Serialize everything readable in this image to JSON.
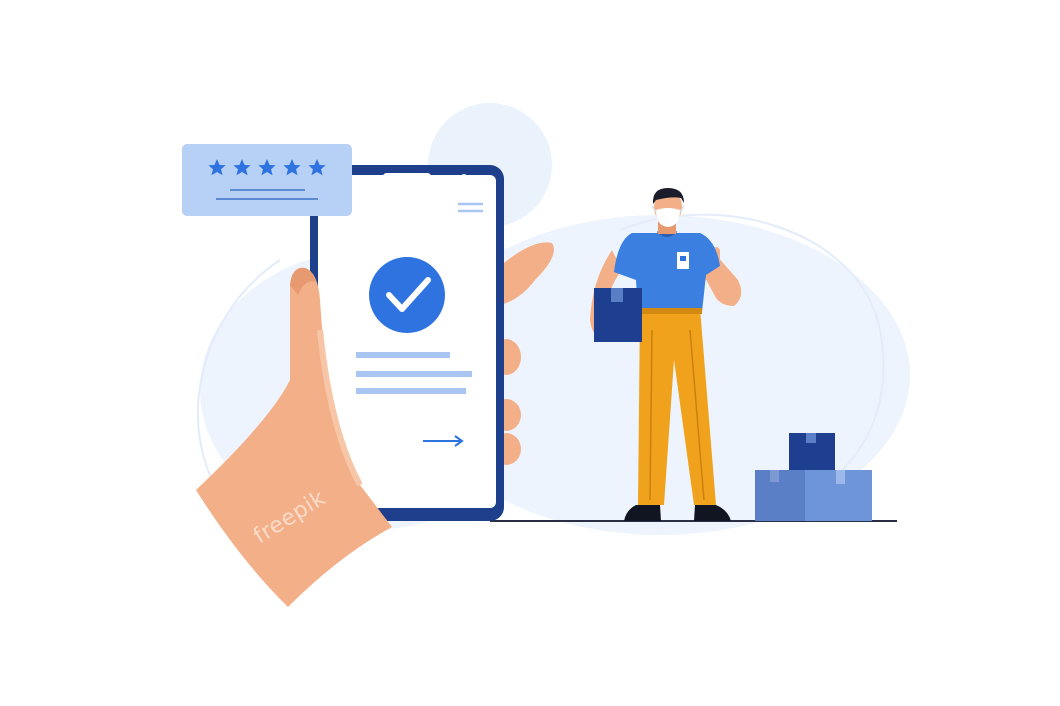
{
  "illustration": {
    "subject": "delivery-confirmation",
    "icons": [
      "hand-icon",
      "smartphone-icon",
      "check-circle-icon",
      "star-icon",
      "arrow-right-icon",
      "package-icon",
      "courier-icon"
    ]
  },
  "rating_card": {
    "stars_filled": 5,
    "stars_total": 5
  },
  "watermark": {
    "text": "freepik"
  },
  "colors": {
    "background": "#ffffff",
    "blob": "#eaf2fc",
    "phone_frame": "#1d3f8c",
    "phone_screen": "#ffffff",
    "accent_blue": "#2f73e0",
    "light_blue": "#a9c6f2",
    "card_blue": "#b7d0f5",
    "skin": "#f3b088",
    "skin_dark": "#e79a6f",
    "shirt": "#3b7fe0",
    "pants": "#f0a21c",
    "box_dark": "#1e3f8f",
    "box_mid": "#5b7fc7",
    "box_light": "#6d95d8",
    "ground": "#2b2f45"
  }
}
